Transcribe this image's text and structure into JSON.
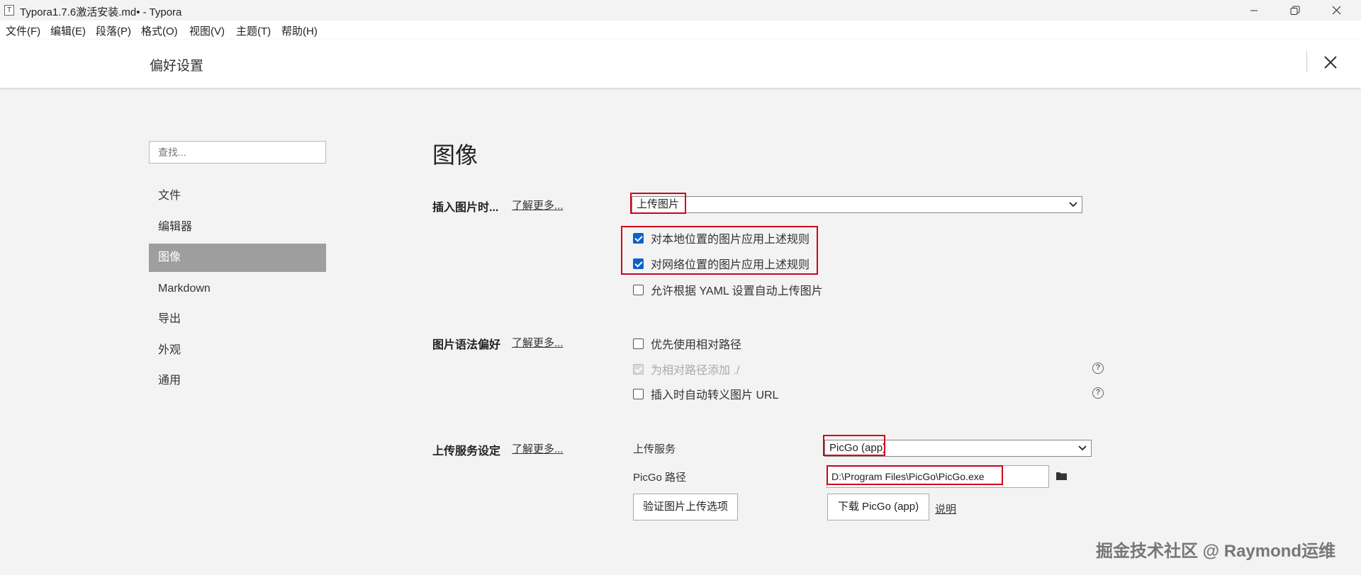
{
  "window": {
    "icon_letter": "T",
    "title": "Typora1.7.6激活安装.md• - Typora"
  },
  "menu": [
    "文件(F)",
    "编辑(E)",
    "段落(P)",
    "格式(O)",
    "视图(V)",
    "主题(T)",
    "帮助(H)"
  ],
  "header": {
    "title": "偏好设置"
  },
  "sidebar": {
    "search_placeholder": "查找...",
    "items": [
      {
        "label": "文件"
      },
      {
        "label": "编辑器"
      },
      {
        "label": "图像",
        "active": true
      },
      {
        "label": "Markdown"
      },
      {
        "label": "导出"
      },
      {
        "label": "外观"
      },
      {
        "label": "通用"
      }
    ]
  },
  "main": {
    "section_title": "图像",
    "learn_more": "了解更多...",
    "insert": {
      "label": "插入图片时...",
      "select_value": "上传图片",
      "options": [
        {
          "label": "对本地位置的图片应用上述规则",
          "checked": true
        },
        {
          "label": "对网络位置的图片应用上述规则",
          "checked": true
        },
        {
          "label": "允许根据 YAML 设置自动上传图片",
          "checked": false
        }
      ]
    },
    "syntax": {
      "label": "图片语法偏好",
      "options": [
        {
          "label": "优先使用相对路径",
          "checked": false
        },
        {
          "label": "为相对路径添加 ./",
          "checked": true,
          "disabled": true
        },
        {
          "label": "插入时自动转义图片 URL",
          "checked": false
        }
      ],
      "help_glyph": "?"
    },
    "upload": {
      "label": "上传服务设定",
      "service_label": "上传服务",
      "service_value": "PicGo (app)",
      "path_label": "PicGo 路径",
      "path_value": "D:\\Program Files\\PicGo\\PicGo.exe",
      "verify_button": "验证图片上传选项",
      "download_button": "下载 PicGo (app)",
      "explain_link": "说明"
    }
  },
  "watermark": "掘金技术社区 @ Raymond运维",
  "colors": {
    "highlight_box": "#d0021b",
    "checkbox_on": "#0a62c9",
    "active_nav": "#9e9e9e"
  }
}
